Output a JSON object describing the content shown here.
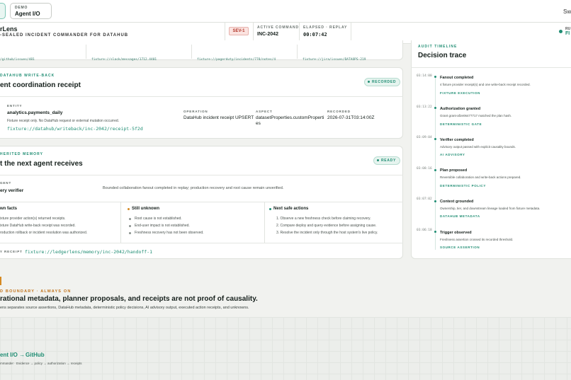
{
  "header": {
    "demo_label": "DEMO",
    "demo_value": "Agent I/O",
    "top_right": "Swi",
    "app_name": "rLens",
    "app_tagline": "-SEALED INCIDENT COMMANDER FOR DATAHUB",
    "severity": "SEV-1",
    "active_command_label": "ACTIVE COMMAND",
    "active_command_value": "INC-2042",
    "elapsed_label": "ELAPSED · REPLAY",
    "elapsed_value": "00:07:42",
    "run_label": "RU",
    "run_value": "FI"
  },
  "links": [
    "/github/issues/481",
    "fixture://slack/messages/1712.4401",
    "fixture://pagerduty/incidents/778/notes/4",
    "fixture://jira/issues/DATAOPS-219"
  ],
  "writeback": {
    "kicker": "DATAHUB WRITE-BACK",
    "title": "ent coordination receipt",
    "badge": "RECORDED",
    "entity_label": "ENTITY",
    "entity_value": "analytics.payments_daily",
    "entity_note": "Fixture receipt only. No DataHub request or external mutation occurred.",
    "entity_link": "fixture://datahub/writeback/inc-2042/receipt-5f2d",
    "operation_label": "OPERATION",
    "operation_value": "DataHub incident receipt UPSERT",
    "aspect_label": "ASPECT",
    "aspect_value_1": "datasetProperties.customProperti",
    "aspect_value_2": "es",
    "recorded_label": "RECORDED",
    "recorded_value": "2026-07-31T03:14:00Z"
  },
  "memory": {
    "kicker": "HERITED MEMORY",
    "title": "t the next agent receives",
    "badge": "READY",
    "agent_label": "GENT",
    "agent_value": "ery verifier",
    "summary": "Bounded collaboration fanout completed in replay; production recovery and root cause remain unverified.",
    "col1": {
      "title": "wn facts",
      "items": [
        "ixture provider action(s) returned receipts.",
        "ixture DataHub write-back receipt was recorded.",
        "roduction rollback or incident resolution was authorized."
      ]
    },
    "col2": {
      "title": "Still unknown",
      "items": [
        "Root cause is not established.",
        "End-user impact is not established.",
        "Freshness recovery has not been observed."
      ]
    },
    "col3": {
      "title": "Next safe actions",
      "items": [
        "1.  Observe a new freshness check before claiming recovery.",
        "2.  Compare deploy and query evidence before assigning cause.",
        "3.  Resolve the incident only through the host system's live policy."
      ]
    },
    "receipt_label": "Y RECEIPT",
    "receipt_link": "fixture://ledgerlens/memory/inc-2042/handoff-1"
  },
  "timeline": {
    "kicker": "AUDIT TIMELINE",
    "title": "Decision trace",
    "events": [
      {
        "time": "03:14:00",
        "title": "Fanout completed",
        "desc": "4 fixture provider receipt(s) and one write-back receipt recorded.",
        "tag": "FIXTURE EXECUTION"
      },
      {
        "time": "03:13:22",
        "title": "Authorization granted",
        "desc": "Grant grant-af2e06477717 matched the plan hash.",
        "tag": "DETERMINISTIC GATE"
      },
      {
        "time": "03:09:04",
        "title": "Verifier completed",
        "desc": "Advisory output passed with explicit causality bounds.",
        "tag": "AI ADVISORY"
      },
      {
        "time": "03:08:16",
        "title": "Plan proposed",
        "desc": "Reversible collaboration and write-back actions prepared.",
        "tag": "DETERMINISTIC POLICY"
      },
      {
        "time": "03:07:02",
        "title": "Context grounded",
        "desc": "Ownership, tier, and downstream lineage loaded from fixture metadata.",
        "tag": "DATAHUB METADATA"
      },
      {
        "time": "03:06:18",
        "title": "Trigger observed",
        "desc": "Freshness assertion crossed its recorded threshold.",
        "tag": "SOURCE ASSERTION"
      }
    ]
  },
  "boundary": {
    "kicker": "D BOUNDARY · ALWAYS ON",
    "title": "rational metadata, planner proposals, and receipts are not proof of causality.",
    "desc": "ens separates source assertions, DataHub metadata, deterministic policy decisions, AI advisory output, executed action receipts, and unknowns."
  },
  "footer": {
    "brand": "ent I/O  →",
    "github": "GitHub",
    "sub": "mmander · Evidence → policy → authorization → receipts"
  },
  "colors": {
    "accent": "#1f8d73",
    "warning": "#d58a22",
    "danger": "#b33a2e"
  }
}
